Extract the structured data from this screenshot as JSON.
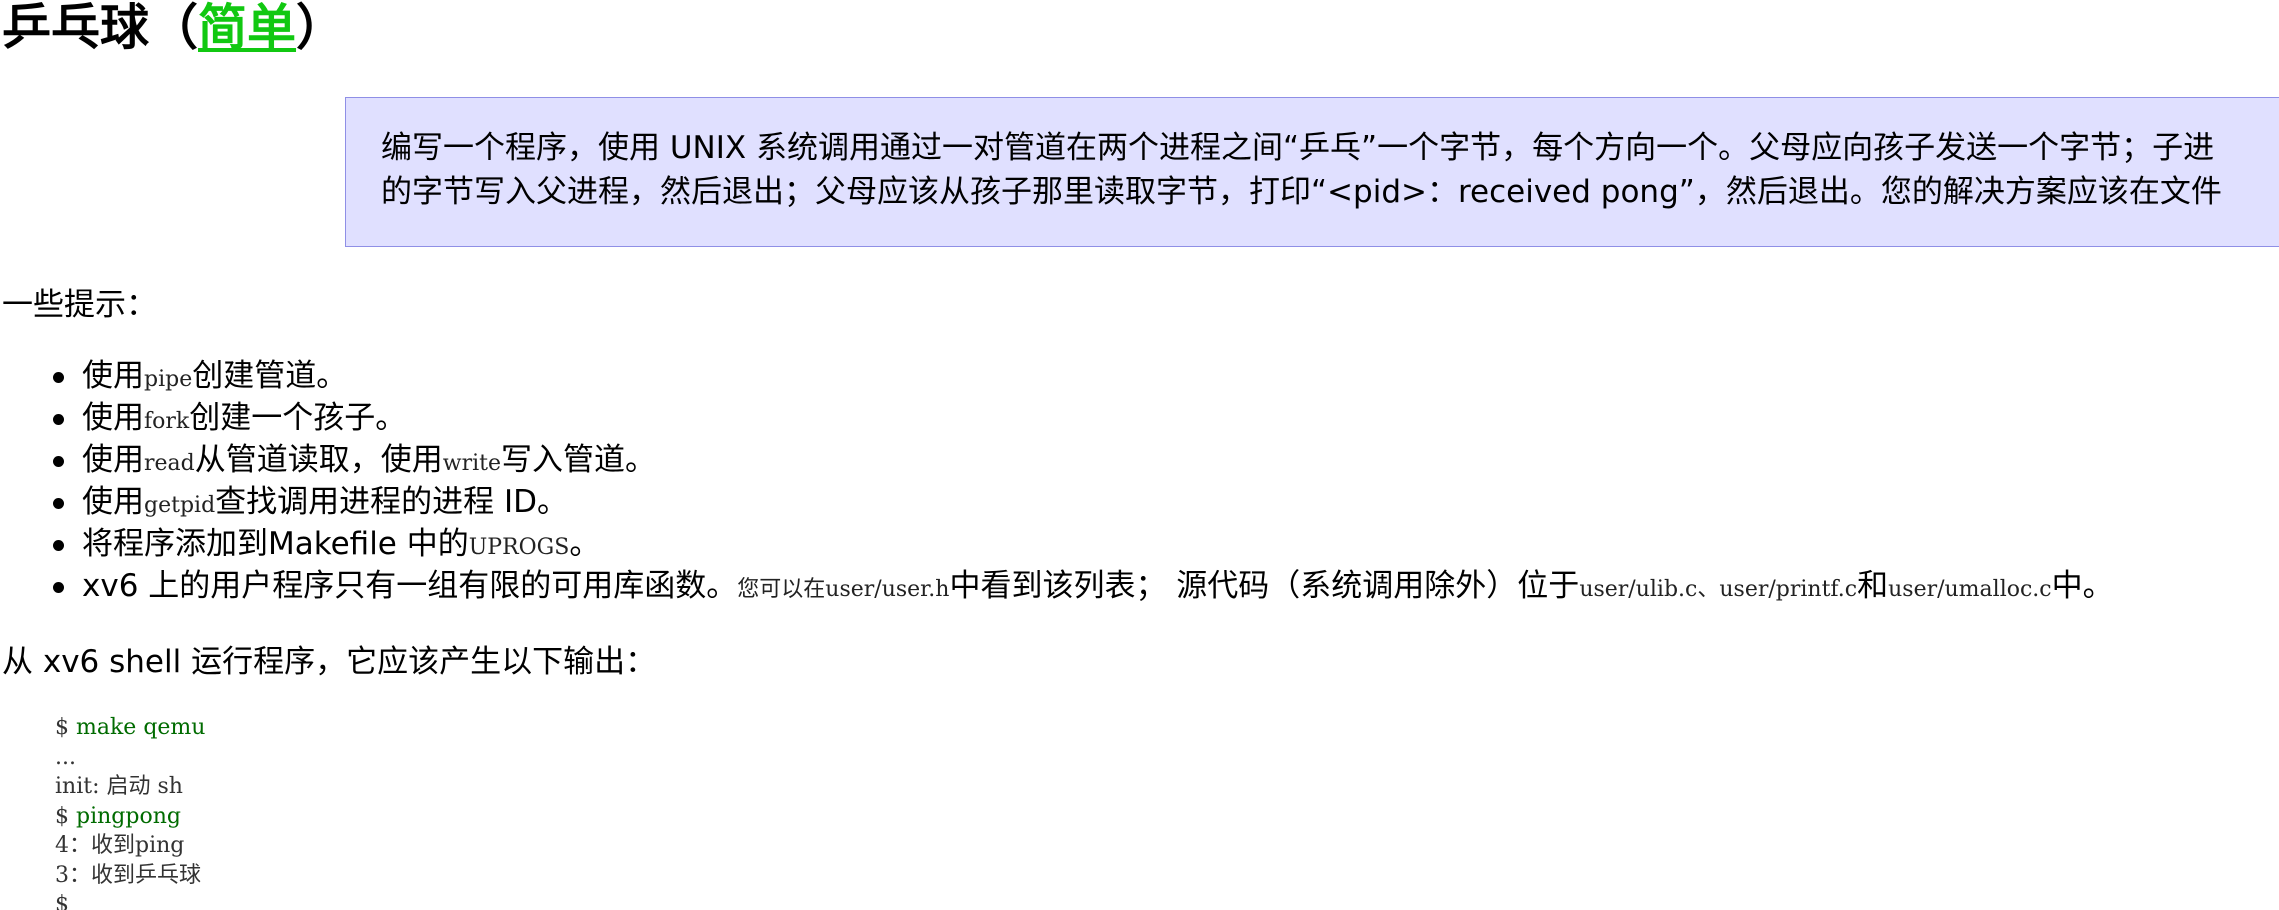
{
  "title": {
    "prefix": "乒乓球（",
    "difficulty": "简单",
    "suffix": "）"
  },
  "assignment": {
    "line1": "编写一个程序，使用 UNIX 系统调用通过一对管道在两个进程之间“乒乓”一个字节，每个方向一个。父母应向孩子发送一个字节；子进",
    "line2": "的字节写入父进程，然后退出；父母应该从孩子那里读取字节，打印“<pid>：received pong”，然后退出。您的解决方案应该在文件"
  },
  "hints_intro": "一些提示：",
  "hints": [
    {
      "pre": "使用",
      "code": "pipe",
      "post": "创建管道。"
    },
    {
      "pre": "使用",
      "code": "fork",
      "post": "创建一个孩子。"
    },
    {
      "pre": "使用",
      "code": "read",
      "mid": "从管道读取，使用",
      "code2": "write",
      "post": "写入管道。"
    },
    {
      "pre": "使用",
      "code": "getpid",
      "post": "查找调用进程的进程 ID。"
    },
    {
      "pre": "将程序添加到Makefile 中的",
      "code": "UPROGS",
      "post": "。"
    },
    {
      "pre": "xv6 上的用户程序只有一组有限的可用库函数。",
      "small": "您可以在",
      "code": "user/user.h",
      "mid": "中看到该列表； 源代码（系统调用除外）位于",
      "code2": "user/ulib.c",
      "sep": "、",
      "code3": "user/printf.c",
      "and": "和",
      "code4": "user/umalloc.c",
      "post": "中。"
    }
  ],
  "run_intro": "从 xv6 shell 运行程序，它应该产生以下输出：",
  "terminal": {
    "prompt": "$ ",
    "cmd1": "make qemu",
    "line_dots": "...",
    "line_init": "init: 启动 sh",
    "cmd2": "pingpong",
    "line_out1": "4：收到ping",
    "line_out2": "3：收到乒乓球",
    "line_last": "$"
  },
  "colors": {
    "difficulty_link": "#11c811",
    "box_background": "#e0e0ff",
    "box_border": "#8f8fe6",
    "command_text": "#006b00"
  }
}
